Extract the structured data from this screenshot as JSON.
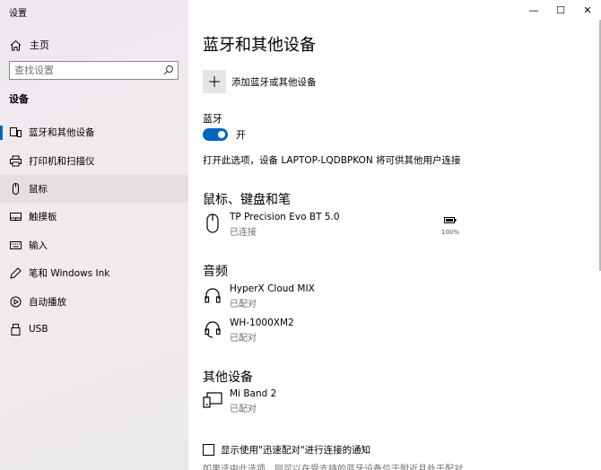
{
  "window": {
    "title": "设置",
    "controls": {
      "minimize": "—",
      "maximize": "☐",
      "close": "✕"
    }
  },
  "sidebar": {
    "home_label": "主页",
    "search_placeholder": "查找设置",
    "section_label": "设备",
    "items": [
      {
        "label": "蓝牙和其他设备",
        "icon": "bluetooth-devices-icon",
        "active": true
      },
      {
        "label": "打印机和扫描仪",
        "icon": "printer-icon"
      },
      {
        "label": "鼠标",
        "icon": "mouse-icon",
        "hover": true
      },
      {
        "label": "触摸板",
        "icon": "touchpad-icon"
      },
      {
        "label": "输入",
        "icon": "keyboard-icon"
      },
      {
        "label": "笔和 Windows Ink",
        "icon": "pen-icon"
      },
      {
        "label": "自动播放",
        "icon": "autoplay-icon"
      },
      {
        "label": "USB",
        "icon": "usb-icon"
      }
    ]
  },
  "main": {
    "title": "蓝牙和其他设备",
    "add_device_label": "添加蓝牙或其他设备",
    "bluetooth": {
      "label": "蓝牙",
      "toggle_state": "开",
      "discoverable_text": "打开此选项，设备 LAPTOP-LQDBPKON 将可供其他用户连接"
    },
    "groups": {
      "mouse_keyboard_pen": {
        "title": "鼠标、键盘和笔",
        "devices": [
          {
            "name": "TP Precision Evo BT 5.0",
            "status": "已连接",
            "battery": "100%",
            "icon": "mouse-icon"
          }
        ]
      },
      "audio": {
        "title": "音频",
        "devices": [
          {
            "name": "HyperX Cloud MIX",
            "status": "已配对",
            "icon": "headphones-icon"
          },
          {
            "name": "WH-1000XM2",
            "status": "已配对",
            "icon": "headset-icon"
          }
        ]
      },
      "other": {
        "title": "其他设备",
        "devices": [
          {
            "name": "Mi Band 2",
            "status": "已配对",
            "icon": "other-device-icon"
          }
        ]
      }
    },
    "swift_pair_label": "显示使用\"迅速配对\"进行连接的通知",
    "swift_pair_desc": "如果选中此选项，则可以在受支持的蓝牙设备位于附近且处于配对"
  },
  "colors": {
    "accent": "#0067c0"
  }
}
